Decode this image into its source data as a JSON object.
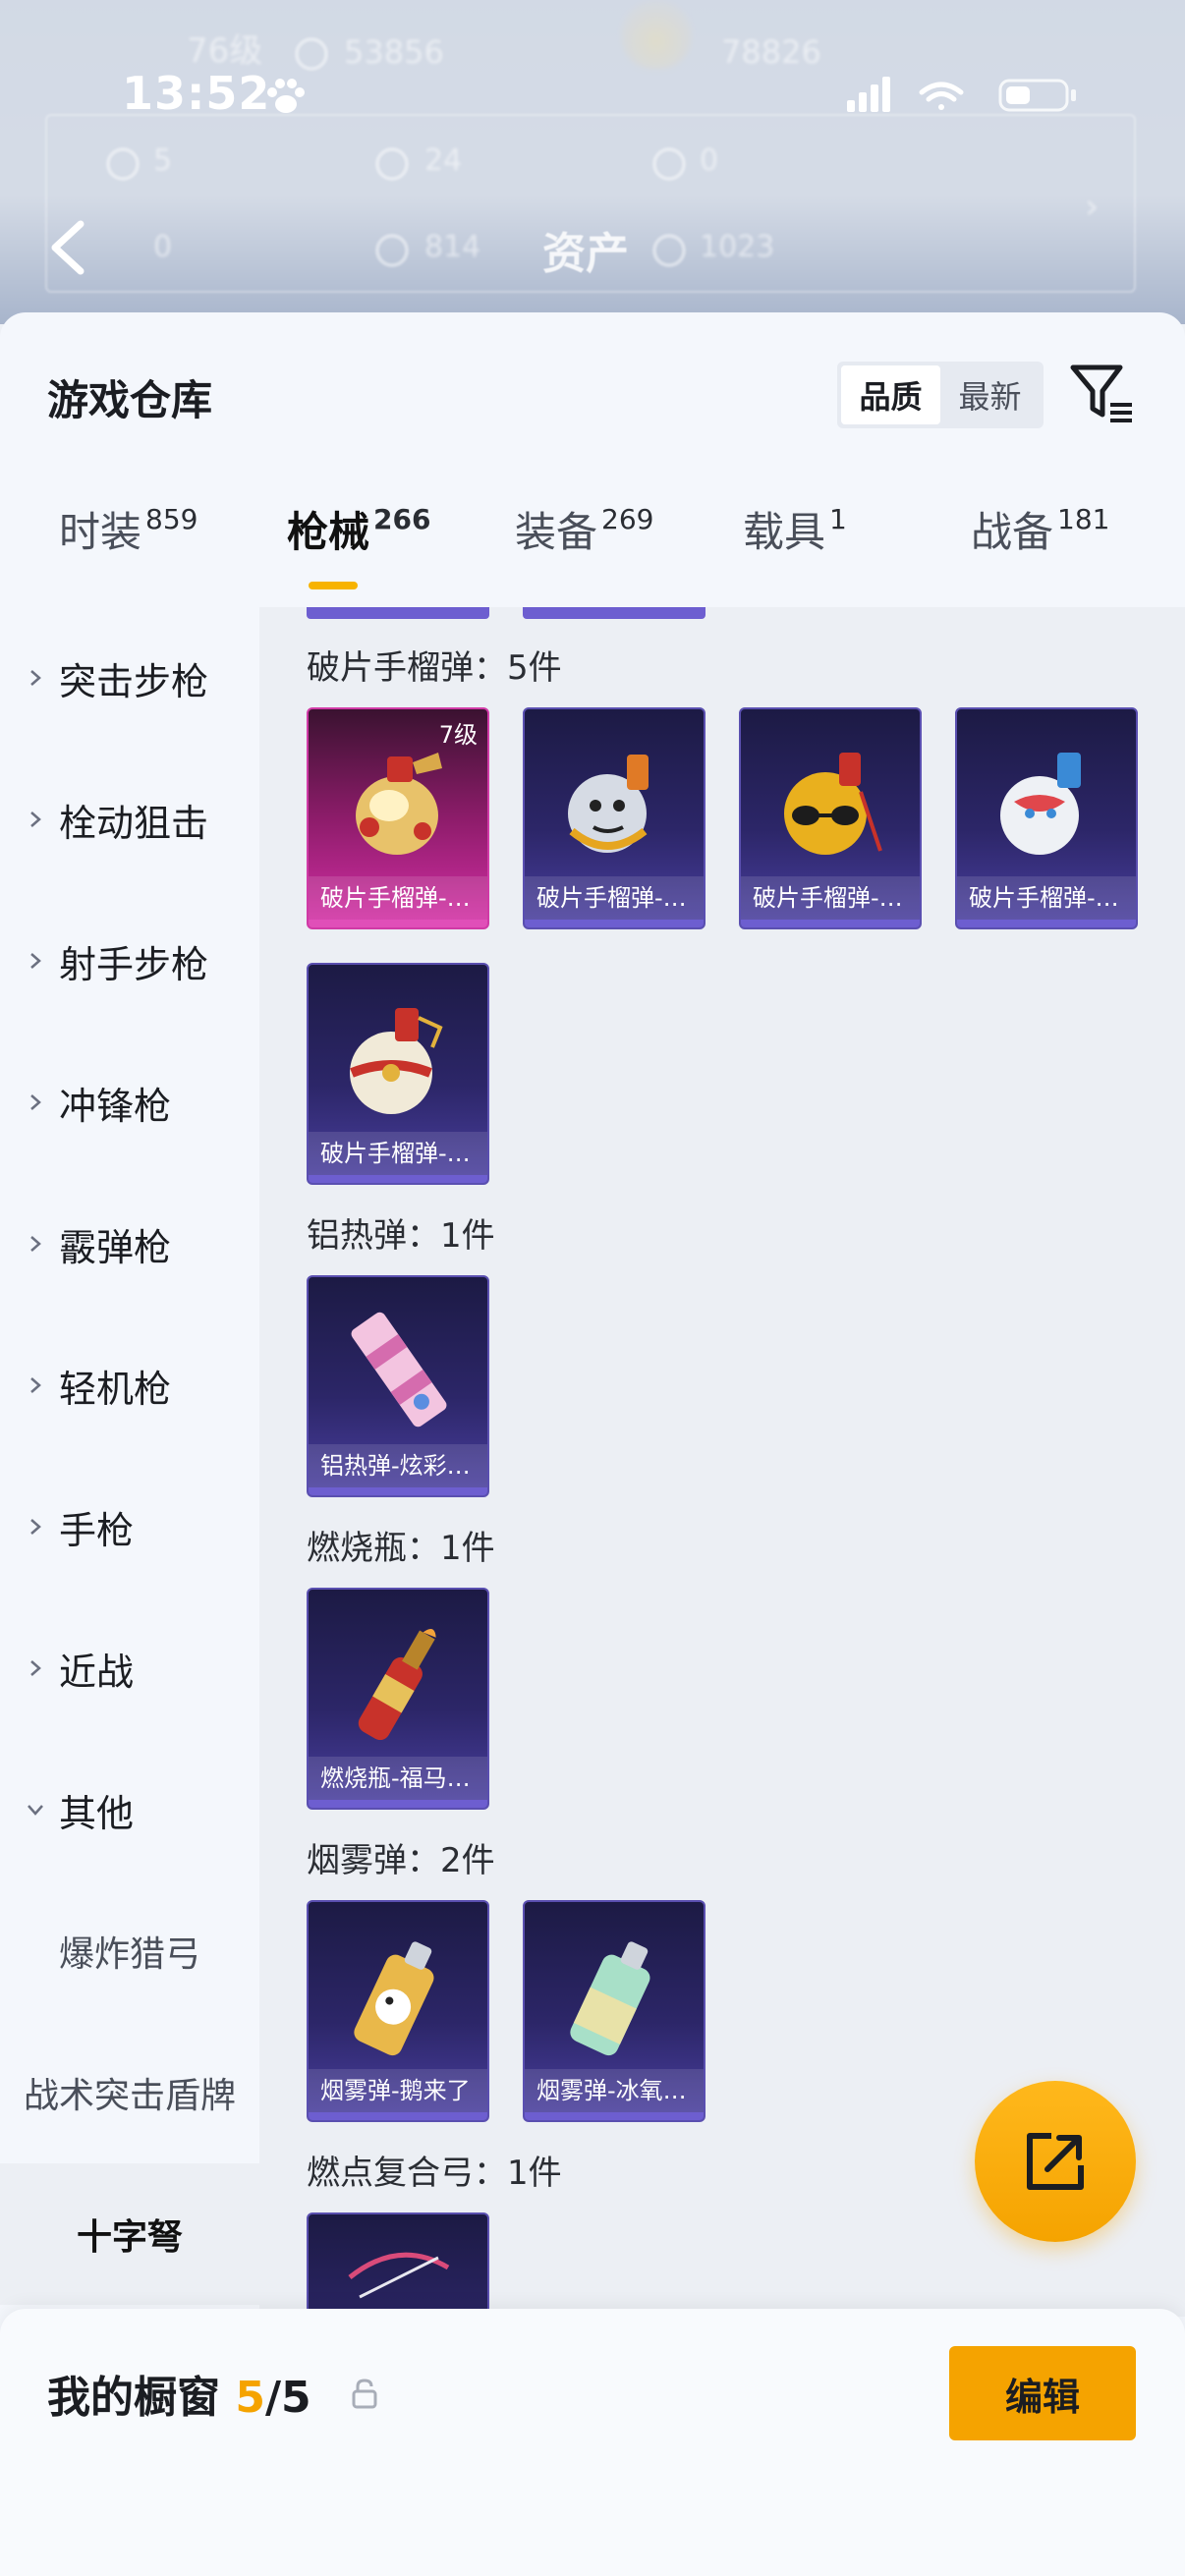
{
  "status_bar": {
    "time": "13:52"
  },
  "background_header": {
    "title": "资产",
    "level_text": "76级",
    "stat_1": "53856",
    "stat_2": "78826",
    "row1": [
      "5",
      "24",
      "0"
    ],
    "row2": [
      "0",
      "814",
      "1023"
    ]
  },
  "sheet": {
    "title": "游戏仓库",
    "sort_options": [
      "品质",
      "最新"
    ],
    "active_sort": "品质"
  },
  "tabs": [
    {
      "label": "时装",
      "count": "859"
    },
    {
      "label": "枪械",
      "count": "266"
    },
    {
      "label": "装备",
      "count": "269"
    },
    {
      "label": "载具",
      "count": "1"
    },
    {
      "label": "战备",
      "count": "181"
    }
  ],
  "active_tab": "枪械",
  "sidebar": {
    "categories": [
      "突击步枪",
      "栓动狙击",
      "射手步枪",
      "冲锋枪",
      "霰弹枪",
      "轻机枪",
      "手枪",
      "近战",
      "其他"
    ],
    "sub_items": [
      "爆炸猎弓",
      "战术突击盾牌",
      "十字弩"
    ],
    "selected": "十字弩"
  },
  "groups": [
    {
      "label": "破片手榴弹：5件",
      "items": [
        {
          "name": "破片手榴弹-…",
          "level": "7级",
          "rarity": "pink"
        },
        {
          "name": "破片手榴弹-…",
          "rarity": "purple"
        },
        {
          "name": "破片手榴弹-…",
          "rarity": "purple"
        },
        {
          "name": "破片手榴弹-…",
          "rarity": "purple"
        },
        {
          "name": "破片手榴弹-…",
          "rarity": "purple"
        }
      ]
    },
    {
      "label": "铝热弹：1件",
      "items": [
        {
          "name": "铝热弹-炫彩…",
          "rarity": "purple"
        }
      ]
    },
    {
      "label": "燃烧瓶：1件",
      "items": [
        {
          "name": "燃烧瓶-福马…",
          "rarity": "purple"
        }
      ]
    },
    {
      "label": "烟雾弹：2件",
      "items": [
        {
          "name": "烟雾弹-鹅来了",
          "rarity": "purple"
        },
        {
          "name": "烟雾弹-冰氧…",
          "rarity": "purple"
        }
      ]
    },
    {
      "label": "燃点复合弓：1件",
      "items": []
    }
  ],
  "footer": {
    "title": "我的橱窗",
    "current": "5",
    "sep_total": "/5",
    "edit_label": "编辑"
  },
  "colors": {
    "accent": "#f5a300",
    "purple_card": "#2c2668",
    "pink_card": "#d52fa6"
  }
}
